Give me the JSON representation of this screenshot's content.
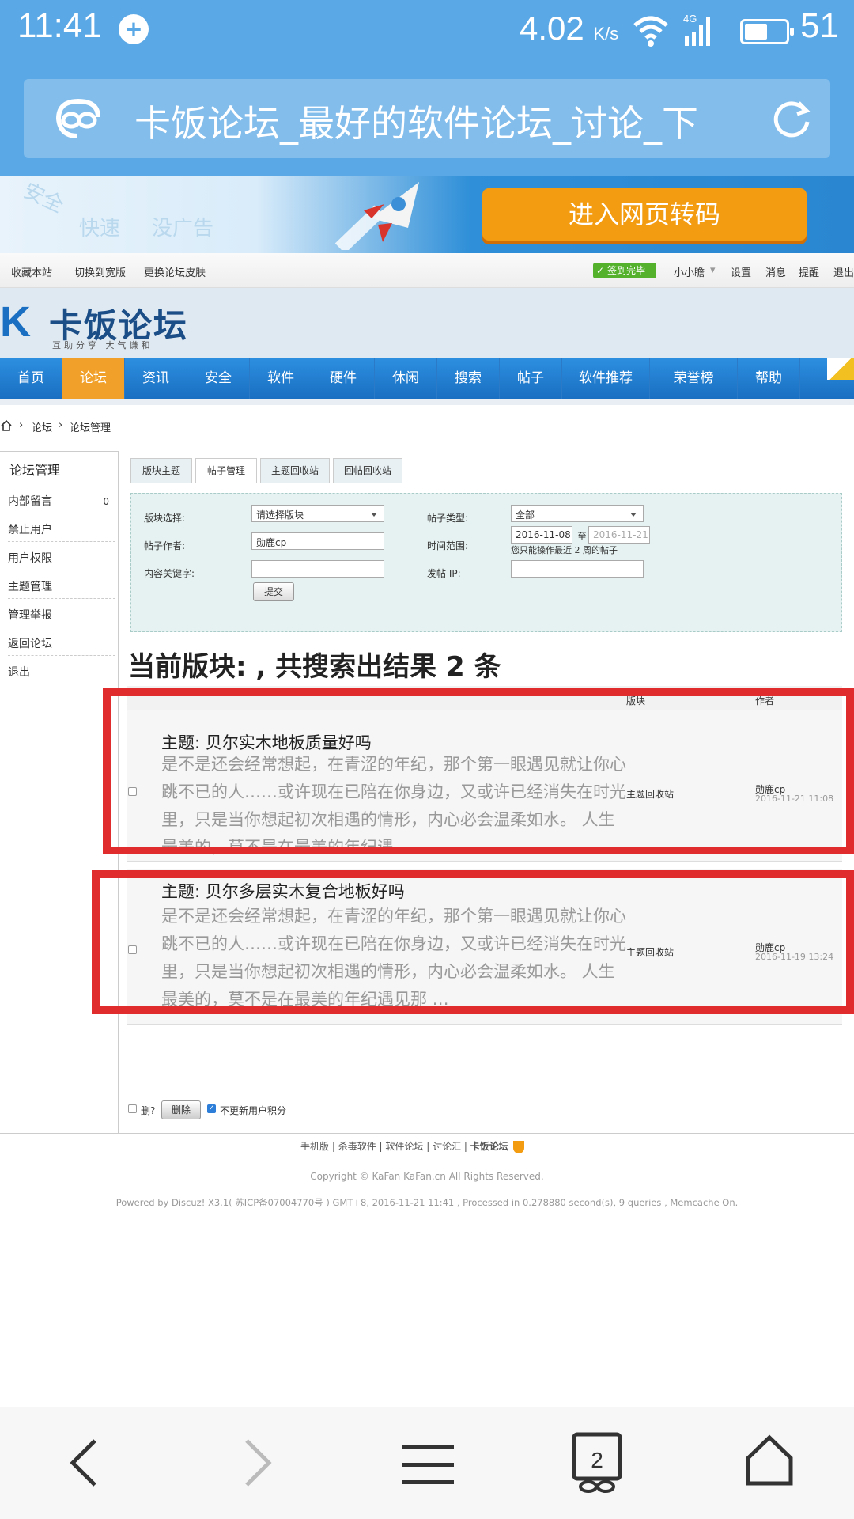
{
  "status": {
    "time": "11:41",
    "speed": "4.02",
    "speed_unit": "K/s",
    "network": "4G",
    "battery": "51"
  },
  "urlbar": {
    "title": "卡饭论坛_最好的软件论坛_讨论_下"
  },
  "banner": {
    "words": [
      "安全",
      "快速",
      "没广告"
    ],
    "button": "进入网页转码"
  },
  "toplinks": {
    "left": [
      "收藏本站",
      "切换到宽版",
      "更换论坛皮肤"
    ],
    "sign": "签到完毕",
    "user": "小小瞻",
    "right": [
      "设置",
      "消息",
      "提醒",
      "退出"
    ]
  },
  "logo": {
    "name": "卡饭论坛",
    "tagline": "互助分享  大气谦和"
  },
  "nav": [
    "首页",
    "论坛",
    "资讯",
    "安全",
    "软件",
    "硬件",
    "休闲",
    "搜索",
    "帖子",
    "软件推荐",
    "荣誉榜",
    "帮助"
  ],
  "breadcrumb": [
    "论坛",
    "论坛管理"
  ],
  "sidebar": {
    "title": "论坛管理",
    "items": [
      "内部留言",
      "禁止用户",
      "用户权限",
      "主题管理",
      "管理举报",
      "返回论坛",
      "退出"
    ],
    "message_count": "0"
  },
  "tabs": [
    "版块主题",
    "帖子管理",
    "主题回收站",
    "回帖回收站"
  ],
  "filter": {
    "forum_label": "版块选择:",
    "forum_value": "请选择版块",
    "type_label": "帖子类型:",
    "type_value": "全部",
    "author_label": "帖子作者:",
    "author_value": "勋鹿cp",
    "range_label": "时间范围:",
    "date_from": "2016-11-08",
    "date_sep": "至",
    "date_to": "2016-11-21",
    "range_note": "您只能操作最近 2 周的帖子",
    "keyword_label": "内容关键字:",
    "ip_label": "发帖 IP:",
    "submit": "提交"
  },
  "result_title": "当前版块: , 共搜索出结果 2 条",
  "table": {
    "col_forum": "版块",
    "col_author": "作者",
    "rows": [
      {
        "subject": "主题: 贝尔实木地板质量好吗",
        "excerpt": "是不是还会经常想起，在青涩的年纪，那个第一眼遇见就让你心跳不已的人……或许现在已陪在你身边，又或许已经消失在时光里，只是当你想起初次相遇的情形，内心必会温柔如水。 人生最美的，莫不是在最美的年纪遇 …",
        "forum": "主题回收站",
        "author": "勋鹿cp",
        "date": "2016-11-21 11:08"
      },
      {
        "subject": "主题: 贝尔多层实木复合地板好吗",
        "excerpt": "是不是还会经常想起，在青涩的年纪，那个第一眼遇见就让你心跳不已的人……或许现在已陪在你身边，又或许已经消失在时光里，只是当你想起初次相遇的情形，内心必会温柔如水。 人生最美的，莫不是在最美的年纪遇见那 …",
        "forum": "主题回收站",
        "author": "勋鹿cp",
        "date": "2016-11-19 13:24"
      }
    ]
  },
  "actions": {
    "del_label": "删?",
    "delete_button": "删除",
    "no_update_label": "不更新用户积分"
  },
  "footer": {
    "links": [
      "手机版",
      "杀毒软件",
      "软件论坛",
      "讨论汇",
      "卡饭论坛"
    ],
    "copyright": "Copyright © KaFan  KaFan.cn All Rights Reserved.",
    "powered": "Powered by Discuz! X3.1( 苏ICP备07004770号 ) GMT+8, 2016-11-21 11:41 , Processed in 0.278880 second(s), 9 queries , Memcache On."
  },
  "bottombar": {
    "tab_count": "2"
  },
  "colors": {
    "status_bg": "#5aa8e6",
    "nav_blue": "#1a6fc2",
    "nav_active": "#f1a12a",
    "banner_button": "#f39c12",
    "highlight_box": "#e02c2c"
  }
}
